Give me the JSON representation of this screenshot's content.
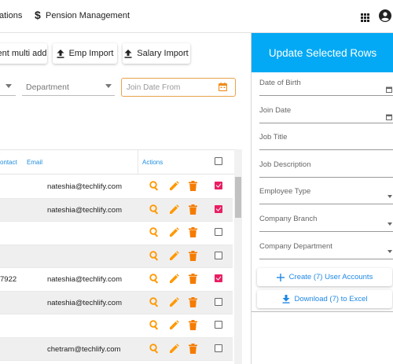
{
  "nav": {
    "items": [
      "ations",
      "Pension Management"
    ],
    "icons": [
      "dollar-icon",
      "apps-grid-icon",
      "account-circle-icon"
    ]
  },
  "toolbar": {
    "buttons": [
      {
        "label": "ent multi add"
      },
      {
        "label": "Emp Import",
        "icon": "upload-icon"
      },
      {
        "label": "Salary Import",
        "icon": "upload-icon"
      }
    ]
  },
  "filters": {
    "department_placeholder": "Department",
    "join_date_from_placeholder": "Join Date From"
  },
  "table": {
    "headers": {
      "contact": "ontact",
      "email": "Email",
      "actions": "Actions"
    },
    "rows": [
      {
        "contact": "",
        "email": "nateshia@techlify.com",
        "checked": true
      },
      {
        "contact": "",
        "email": "nateshia@techlify.com",
        "checked": true
      },
      {
        "contact": "",
        "email": "",
        "checked": false
      },
      {
        "contact": "",
        "email": "",
        "checked": false
      },
      {
        "contact": "7922",
        "email": "nateshia@techlify.com",
        "checked": true
      },
      {
        "contact": "",
        "email": "nateshia@techlify.com",
        "checked": false
      },
      {
        "contact": "",
        "email": "",
        "checked": false
      },
      {
        "contact": "",
        "email": "chetram@techlify.com",
        "checked": false
      }
    ],
    "action_icons": [
      "search-icon",
      "edit-icon",
      "delete-icon"
    ]
  },
  "panel": {
    "title": "Update Selected Rows",
    "fields": [
      {
        "label": "Date of Birth",
        "kind": "date"
      },
      {
        "label": "Join Date",
        "kind": "date"
      },
      {
        "label": "Job Title",
        "kind": "text"
      },
      {
        "label": "Job Description",
        "kind": "text"
      },
      {
        "label": "Employee Type",
        "kind": "select"
      },
      {
        "label": "Company Branch",
        "kind": "select"
      },
      {
        "label": "Company Department",
        "kind": "select"
      }
    ],
    "create_button": "Create (7) User Accounts",
    "download_button": "Download (7) to Excel"
  },
  "colors": {
    "accent": "#03a9f4",
    "action_orange": "#ff9800",
    "delete_orange": "#f57c00",
    "checkbox_pink": "#e91e63",
    "header_link_blue": "#1f8fe0",
    "button_blue": "#1e88e5"
  }
}
